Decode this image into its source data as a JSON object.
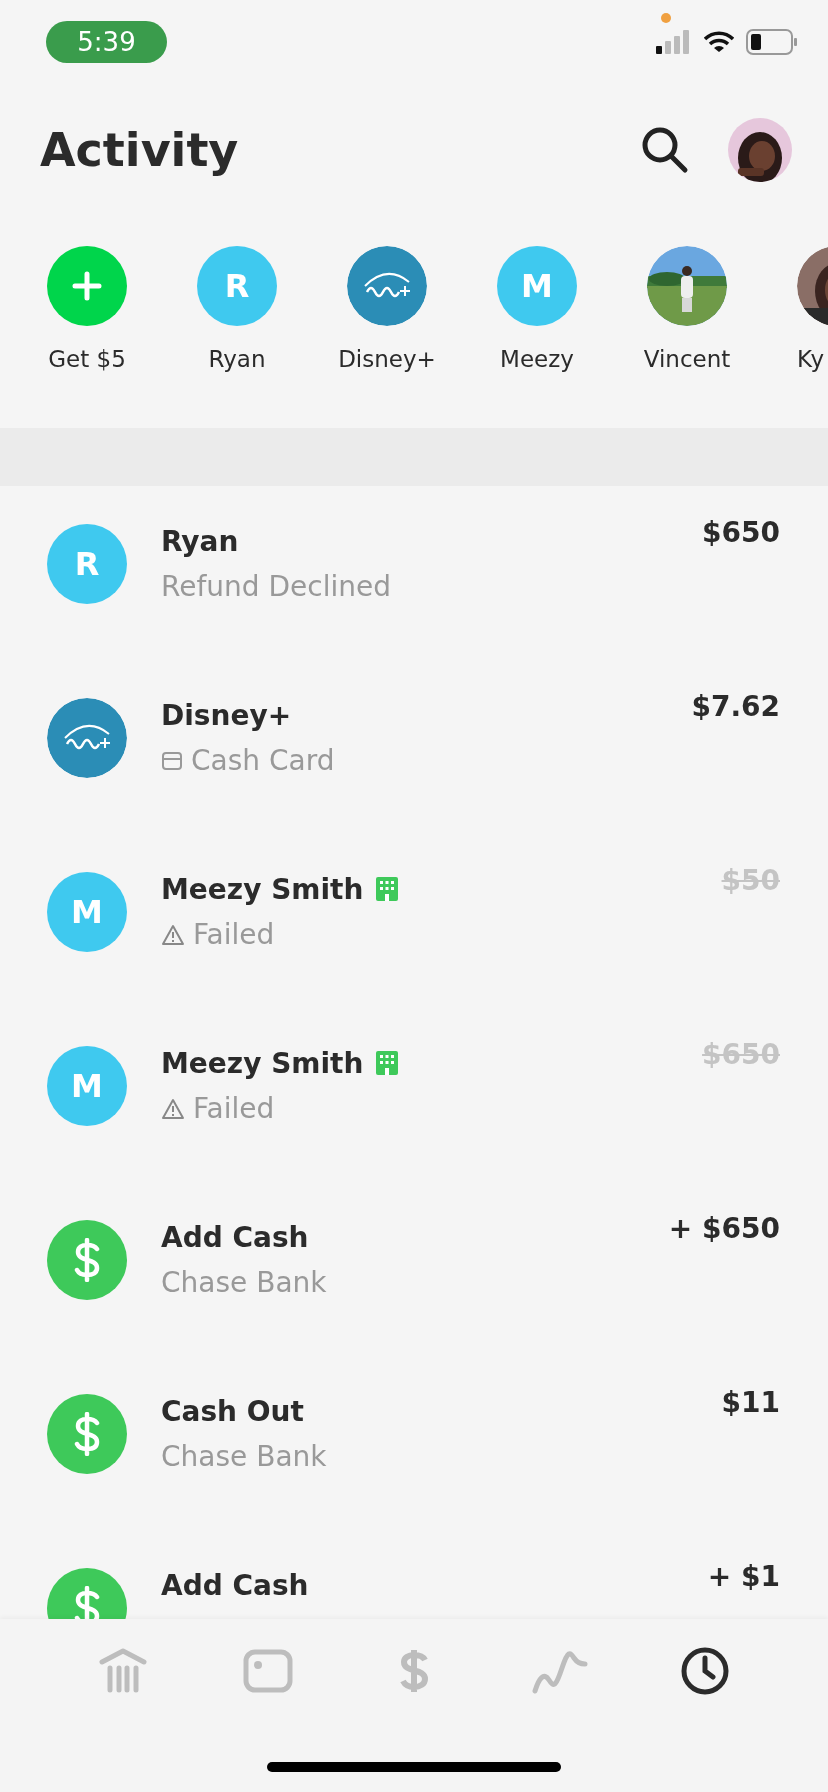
{
  "status_bar": {
    "time": "5:39"
  },
  "header": {
    "title": "Activity"
  },
  "contacts": [
    {
      "label": "Get $5",
      "kind": "add"
    },
    {
      "label": "Ryan",
      "kind": "letter",
      "initial": "R"
    },
    {
      "label": "Disney+",
      "kind": "logo"
    },
    {
      "label": "Meezy",
      "kind": "letter",
      "initial": "M"
    },
    {
      "label": "Vincent"
    },
    {
      "label": "Ky"
    }
  ],
  "activity": [
    {
      "name": "Ryan",
      "avatar": {
        "kind": "letter",
        "initial": "R"
      },
      "subtitle": {
        "kind": "plain",
        "text": "Refund Declined"
      },
      "business": false,
      "amount": "$650",
      "failed": false
    },
    {
      "name": "Disney+",
      "avatar": {
        "kind": "logo"
      },
      "subtitle": {
        "kind": "card",
        "text": "Cash Card"
      },
      "business": false,
      "amount": "$7.62",
      "failed": false
    },
    {
      "name": "Meezy Smith",
      "avatar": {
        "kind": "letter",
        "initial": "M"
      },
      "subtitle": {
        "kind": "warning",
        "text": "Failed"
      },
      "business": true,
      "amount": "$50",
      "failed": true
    },
    {
      "name": "Meezy Smith",
      "avatar": {
        "kind": "letter",
        "initial": "M"
      },
      "subtitle": {
        "kind": "warning",
        "text": "Failed"
      },
      "business": true,
      "amount": "$650",
      "failed": true
    },
    {
      "name": "Add Cash",
      "avatar": {
        "kind": "dollar"
      },
      "subtitle": {
        "kind": "plain",
        "text": "Chase Bank"
      },
      "business": false,
      "amount": "+ $650",
      "failed": false
    },
    {
      "name": "Cash Out",
      "avatar": {
        "kind": "dollar"
      },
      "subtitle": {
        "kind": "plain",
        "text": "Chase Bank"
      },
      "business": false,
      "amount": "$11",
      "failed": false
    },
    {
      "name": "Add Cash",
      "avatar": {
        "kind": "dollar"
      },
      "business": false,
      "amount": "+ $1",
      "failed": false
    }
  ],
  "tab_bar": [
    {
      "kind": "banking",
      "selected": false
    },
    {
      "kind": "card",
      "selected": false
    },
    {
      "kind": "pay",
      "selected": false
    },
    {
      "kind": "investing",
      "selected": false
    },
    {
      "kind": "activity",
      "selected": true
    }
  ]
}
